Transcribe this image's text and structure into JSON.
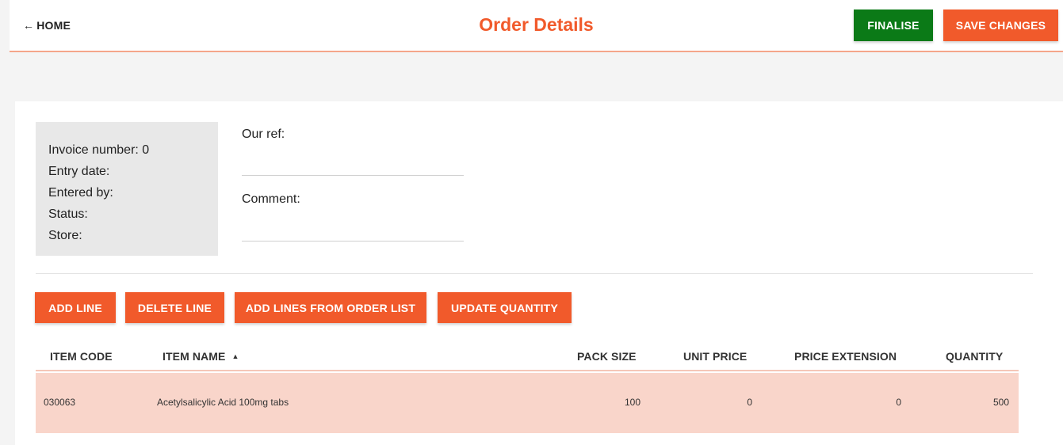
{
  "header": {
    "back_label": "HOME",
    "title": "Order Details",
    "finalise_label": "FINALISE",
    "save_label": "SAVE CHANGES"
  },
  "info": {
    "invoice": "Invoice number: 0",
    "entry_date": "Entry date:",
    "entered_by": "Entered by:",
    "status": "Status:",
    "store": "Store:"
  },
  "fields": {
    "our_ref_label": "Our ref:",
    "our_ref_value": "",
    "comment_label": "Comment:",
    "comment_value": ""
  },
  "toolbar": {
    "add_line": "ADD LINE",
    "delete_line": "DELETE LINE",
    "add_from_list": "ADD LINES FROM ORDER LIST",
    "update_quantity": "UPDATE QUANTITY"
  },
  "table": {
    "columns": {
      "item_code": "ITEM CODE",
      "item_name": "ITEM NAME",
      "pack_size": "PACK SIZE",
      "unit_price": "UNIT PRICE",
      "price_extension": "PRICE EXTENSION",
      "quantity": "QUANTITY"
    },
    "sort_column": "item_name",
    "sort_direction": "ascending",
    "rows": [
      {
        "item_code": "030063",
        "item_name": "Acetylsalicylic Acid 100mg tabs",
        "pack_size": "100",
        "unit_price": "0",
        "price_extension": "0",
        "quantity": "500"
      }
    ]
  },
  "colors": {
    "accent": "#f15a2b",
    "finalise": "#0b7a17",
    "row_highlight": "#f9d5ca",
    "info_box": "#e8e8e8"
  },
  "icons": {
    "back": "arrow-left-icon",
    "sort": "sort-ascending-icon"
  }
}
